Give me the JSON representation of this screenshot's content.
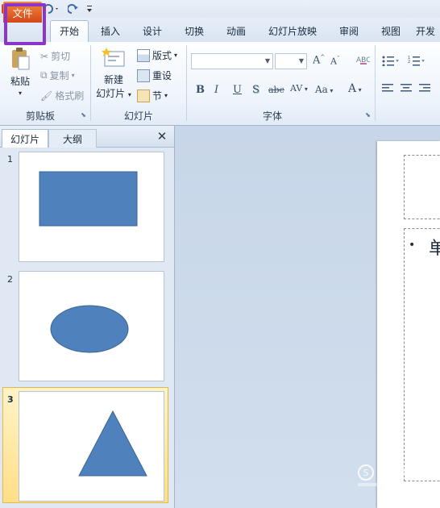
{
  "quick_access": {
    "app_icon": "powerpoint-icon",
    "save_icon": "save-icon",
    "undo_icon": "undo-icon",
    "redo_icon": "redo-icon",
    "customize_icon": "customize-icon"
  },
  "tabs": {
    "file": "文件",
    "home": "开始",
    "insert": "插入",
    "design": "设计",
    "transitions": "切换",
    "animations": "动画",
    "slideshow": "幻灯片放映",
    "review": "审阅",
    "view": "视图",
    "developer": "开发"
  },
  "ribbon": {
    "clipboard": {
      "paste": "粘贴",
      "cut": "剪切",
      "copy": "复制",
      "format_painter": "格式刷",
      "label": "剪贴板"
    },
    "slides": {
      "new_slide_line1": "新建",
      "new_slide_line2": "幻灯片",
      "layout": "版式",
      "reset": "重设",
      "section": "节",
      "label": "幻灯片"
    },
    "font": {
      "font_name": "",
      "font_size": "",
      "bold": "B",
      "italic": "I",
      "underline": "U",
      "shadow": "S",
      "strike": "abc",
      "spacing": "AV",
      "case": "Aa",
      "color": "A",
      "grow": "A",
      "shrink": "A",
      "label": "字体"
    }
  },
  "panel": {
    "tab_slides": "幻灯片",
    "tab_outline": "大纲",
    "close": "✕",
    "slides": [
      {
        "number": "1",
        "shape": "rectangle"
      },
      {
        "number": "2",
        "shape": "ellipse"
      },
      {
        "number": "3",
        "shape": "triangle"
      }
    ],
    "selected": 3
  },
  "slide": {
    "bullet": "•",
    "body_text": "单"
  },
  "colors": {
    "file_tab": "#e15a22",
    "highlight": "#8b35c9",
    "shape_fill": "#4f81bd",
    "shape_stroke": "#3a6496"
  }
}
